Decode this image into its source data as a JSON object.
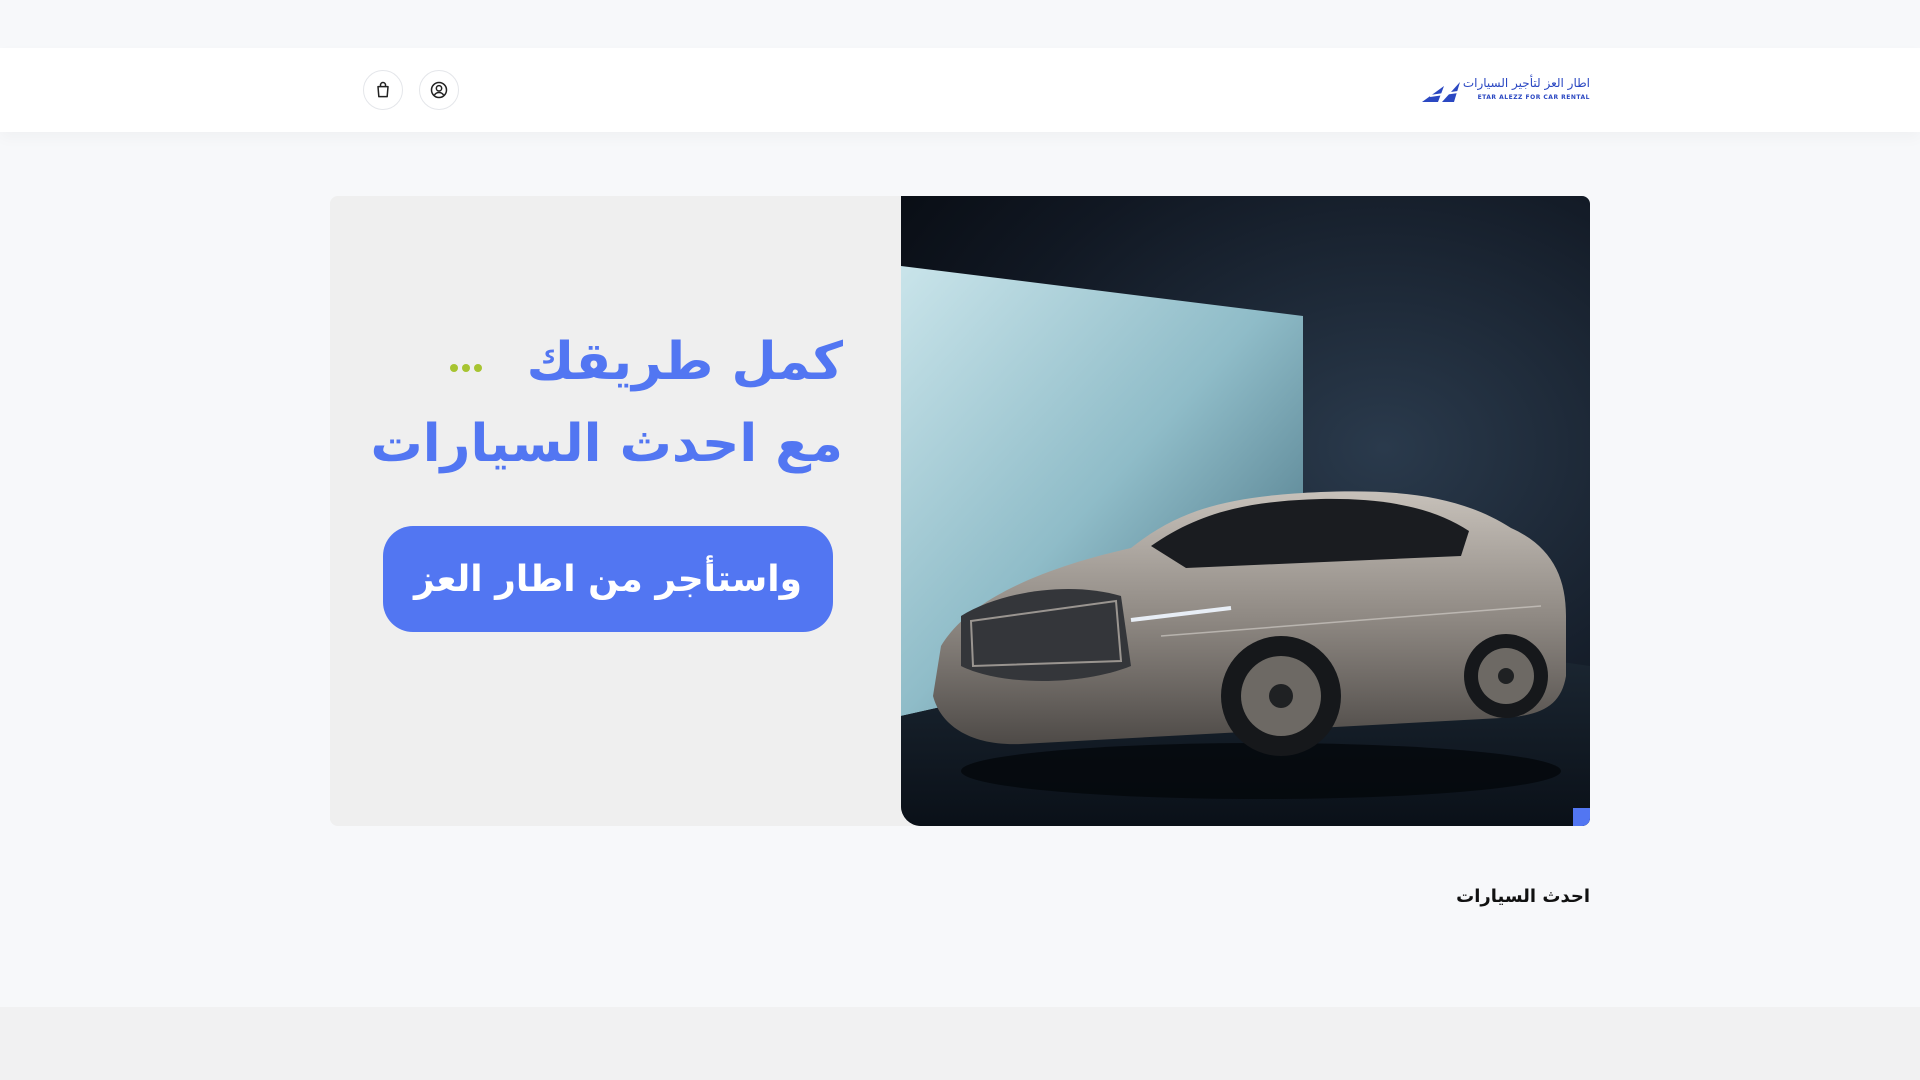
{
  "header": {
    "logo_text_ar": "اطار العز لتأجير السيارات",
    "logo_text_en": "ETAR ALEZZ FOR CAR RENTAL",
    "icons": [
      "cart-icon",
      "user-icon"
    ]
  },
  "hero": {
    "headline_line1": "كمل طريقك",
    "headline_line2": "مع احدث السيارات",
    "cta_label": "واستأجر من اطار العز",
    "accent_color": "#5276f2",
    "dots_color": "#a7c431"
  },
  "latest": {
    "title": "احدث السيارات"
  }
}
